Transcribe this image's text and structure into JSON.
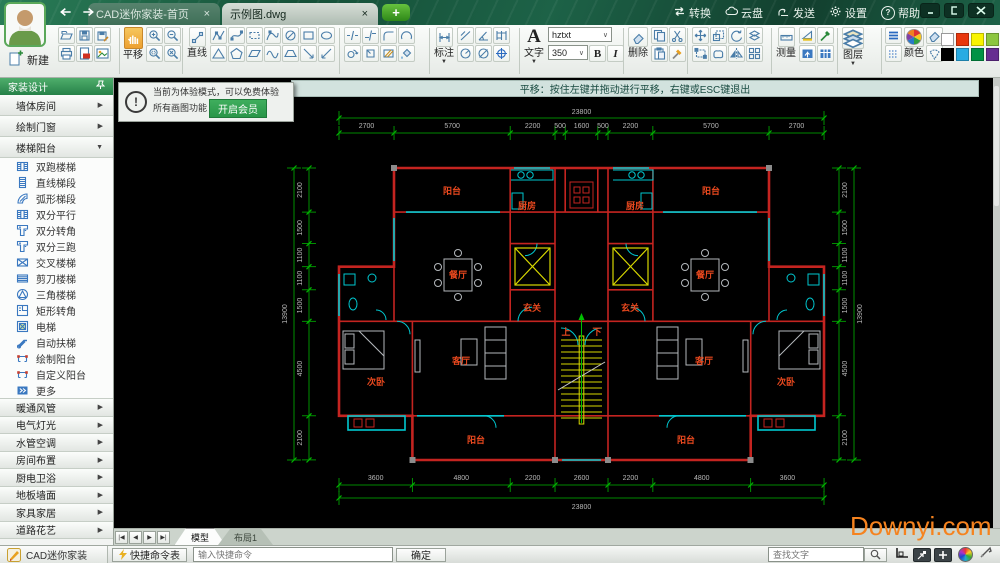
{
  "titlebar": {
    "tabs": [
      {
        "label": "CAD迷你家装-首页",
        "close": "×"
      },
      {
        "label": "示例图.dwg",
        "close": "×"
      }
    ],
    "new_tab": "+",
    "actions": [
      {
        "icon": "convert",
        "label": "转换"
      },
      {
        "icon": "cloud",
        "label": "云盘"
      },
      {
        "icon": "send",
        "label": "发送"
      },
      {
        "icon": "gear",
        "label": "设置"
      },
      {
        "icon": "help",
        "label": "帮助"
      }
    ]
  },
  "toolbar": {
    "new_label": "新建",
    "pan_label": "平移",
    "line_label": "直线",
    "dim_label": "标注",
    "text_label": "文字",
    "text_glyph": "A",
    "font_value": "hztxt",
    "size_value": "350",
    "bold_label": "B",
    "italic_label": "I",
    "erase_label": "删除",
    "measure_label": "测量",
    "layer_label": "图层",
    "color_label": "颜色",
    "palette": [
      "#ffffff",
      "#e8380d",
      "#f8f400",
      "#8cc63f",
      "#000000",
      "#29abe2",
      "#009245",
      "#662d91"
    ]
  },
  "sidebar": {
    "header": "家装设计",
    "sections_top": [
      "墙体房间",
      "绘制门窗"
    ],
    "expanded_section": "楼梯阳台",
    "items": [
      "双跑楼梯",
      "直线梯段",
      "弧形梯段",
      "双分平行",
      "双分转角",
      "双分三跑",
      "交叉楼梯",
      "剪刀楼梯",
      "三角楼梯",
      "矩形转角",
      "电梯",
      "自动扶梯",
      "绘制阳台",
      "自定义阳台",
      "更多"
    ],
    "sections_bottom": [
      "暖通风管",
      "电气灯光",
      "水管空调",
      "房间布置",
      "厨电卫浴",
      "地板墙面",
      "家具家居",
      "道路花艺"
    ]
  },
  "canvas": {
    "notice_line1": "当前为体验模式，可以免费体验",
    "notice_line2": "所有画图功能",
    "notice_button": "开启会员",
    "hint": "平移：按住左键并拖动进行平移，右键或ESC键退出"
  },
  "drawing": {
    "dims": {
      "top_total": "23800",
      "top": [
        "2700",
        "5700",
        "2200",
        "500",
        "1600",
        "500",
        "2200",
        "5700",
        "2700"
      ],
      "bottom": [
        "3600",
        "4800",
        "2200",
        "2600",
        "2200",
        "4800",
        "3600"
      ],
      "bottom_total": "23800",
      "side": [
        "2100",
        "1500",
        "1100",
        "1100",
        "1500",
        "4500",
        "2100"
      ],
      "side_total": "13900"
    },
    "rooms": {
      "balcony": "阳台",
      "kitchen": "厨房",
      "dining": "餐厅",
      "entry": "玄关",
      "bedroom": "次卧",
      "living": "客厅",
      "up": "上",
      "down": "下"
    }
  },
  "bottombar": {
    "layout_tabs": [
      "模型",
      "布局1"
    ],
    "app_label": "CAD迷你家装",
    "shortcut_button": "快捷命令表",
    "cmd_placeholder": "输入快捷命令",
    "ok_button": "确定",
    "find_placeholder": "查找文字"
  },
  "watermark": "Downyi.com"
}
